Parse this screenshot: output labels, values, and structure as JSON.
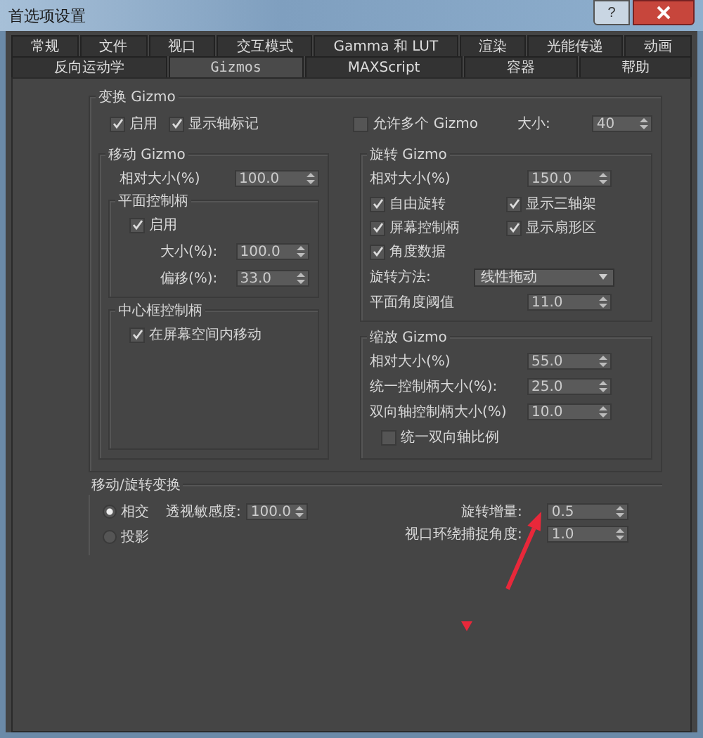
{
  "window": {
    "title": "首选项设置",
    "help": "?"
  },
  "tab_rows": [
    [
      {
        "label": "常规",
        "selected": false
      },
      {
        "label": "文件",
        "selected": false
      },
      {
        "label": "视口",
        "selected": false
      },
      {
        "label": "交互模式",
        "selected": false
      },
      {
        "label": "Gamma 和 LUT",
        "selected": false
      },
      {
        "label": "渲染",
        "selected": false
      },
      {
        "label": "光能传递",
        "selected": false
      },
      {
        "label": "动画",
        "selected": false
      }
    ],
    [
      {
        "label": "反向运动学",
        "selected": false
      },
      {
        "label": "Gizmos",
        "selected": true
      },
      {
        "label": "MAXScript",
        "selected": false
      },
      {
        "label": "容器",
        "selected": false
      },
      {
        "label": "帮助",
        "selected": false
      }
    ]
  ],
  "transform_gizmo": {
    "title": "变换 Gizmo",
    "options": [
      {
        "label": "启用",
        "checked": true
      },
      {
        "label": "显示轴标记",
        "checked": true
      },
      {
        "label": "允许多个 Gizmo",
        "checked": false
      }
    ],
    "size": {
      "label": "大小:",
      "value": "40"
    },
    "move_gizmo": {
      "title": "移动 Gizmo",
      "relative_size": {
        "label": "相对大小(%)",
        "value": "100.0"
      },
      "plane_handles": {
        "title": "平面控制柄",
        "enabled": {
          "label": "启用",
          "checked": true
        },
        "fields": [
          {
            "label": "大小(%):",
            "value": "100.0"
          },
          {
            "label": "偏移(%):",
            "value": "33.0"
          }
        ]
      },
      "center_box_handle": {
        "title": "中心框控制柄",
        "options": [
          {
            "label": "在屏幕空间内移动",
            "checked": true
          }
        ]
      }
    },
    "rotate_gizmo": {
      "title": "旋转 Gizmo",
      "relative_size": {
        "label": "相对大小(%)",
        "value": "150.0"
      },
      "options": [
        {
          "label": "自由旋转",
          "checked": true
        },
        {
          "label": "显示三轴架",
          "checked": true
        },
        {
          "label": "屏幕控制柄",
          "checked": true
        },
        {
          "label": "显示扇形区",
          "checked": true
        },
        {
          "label": "角度数据",
          "checked": true
        }
      ],
      "rotation_method": {
        "label": "旋转方法:",
        "value": "线性拖动"
      },
      "plane_angle_threshold": {
        "label": "平面角度阈值",
        "value": "11.0"
      }
    },
    "scale_gizmo": {
      "title": "缩放 Gizmo",
      "fields": [
        {
          "label": "相对大小(%)",
          "value": "55.0"
        },
        {
          "label": "统一控制柄大小(%):",
          "value": "25.0"
        },
        {
          "label": "双向轴控制柄大小(%)",
          "value": "10.0"
        }
      ],
      "uniform": {
        "label": "统一双向轴比例",
        "checked": false
      }
    }
  },
  "move_rotate_transform": {
    "title": "移动/旋转变换",
    "modes": [
      {
        "label": "相交",
        "selected": true
      },
      {
        "label": "投影",
        "selected": false
      }
    ],
    "perspective_sensitivity": {
      "label": "透视敏感度:",
      "value": "100.0"
    },
    "rotation_increment": {
      "label": "旋转增量:",
      "value": "0.5"
    },
    "orbit_snap_angle": {
      "label": "视口环绕捕捉角度:",
      "value": "1.0"
    }
  }
}
